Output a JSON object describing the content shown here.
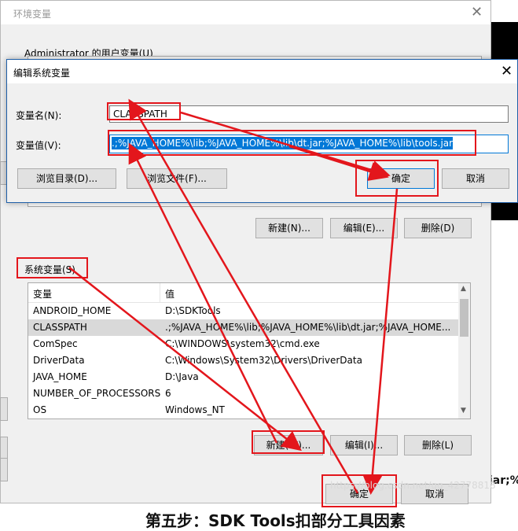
{
  "background": {
    "bottom_text": "第五步：SDK Tools扣部分工具因素",
    "right_text": "jar;%",
    "watermark": "https://blog.csdn.net/qq_42778818"
  },
  "env_window": {
    "title": "环境变量",
    "user_section_label": "Administrator 的用户变量(U)",
    "user_buttons": {
      "new": "新建(N)...",
      "edit": "编辑(E)...",
      "delete": "删除(D)"
    },
    "system_section_label": "系统变量(S)",
    "columns": {
      "variable": "变量",
      "value": "值"
    },
    "system_rows": [
      {
        "name": "ANDROID_HOME",
        "value": "D:\\SDKTools"
      },
      {
        "name": "CLASSPATH",
        "value": ".;%JAVA_HOME%\\lib;%JAVA_HOME%\\lib\\dt.jar;%JAVA_HOME..."
      },
      {
        "name": "ComSpec",
        "value": "C:\\WINDOWS\\system32\\cmd.exe"
      },
      {
        "name": "DriverData",
        "value": "C:\\Windows\\System32\\Drivers\\DriverData"
      },
      {
        "name": "JAVA_HOME",
        "value": "D:\\Java"
      },
      {
        "name": "NUMBER_OF_PROCESSORS",
        "value": "6"
      },
      {
        "name": "OS",
        "value": "Windows_NT"
      }
    ],
    "selected_row_index": 1,
    "system_buttons": {
      "new": "新建(W)...",
      "edit": "编辑(I)...",
      "delete": "删除(L)"
    },
    "footer_buttons": {
      "ok": "确定",
      "cancel": "取消"
    }
  },
  "edit_dialog": {
    "title": "编辑系统变量",
    "name_label": "变量名(N):",
    "name_value": "CLASSPATH",
    "value_label": "变量值(V):",
    "value_value": ".;%JAVA_HOME%\\lib;%JAVA_HOME%\\lib\\dt.jar;%JAVA_HOME%\\lib\\tools.jar",
    "browse_dir": "浏览目录(D)...",
    "browse_file": "浏览文件(F)...",
    "ok": "确定",
    "cancel": "取消"
  },
  "colors": {
    "annotation": "#e3161c",
    "selection": "#0078d7"
  }
}
